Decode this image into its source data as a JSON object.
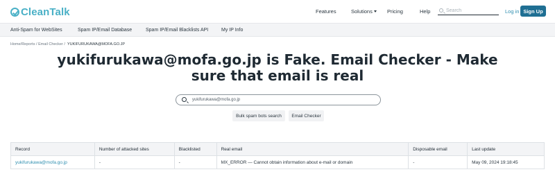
{
  "header": {
    "logo_text": "CleanTalk",
    "nav": [
      "Features",
      "Solutions",
      "Pricing",
      "Help"
    ],
    "search_placeholder": "Search",
    "login_label": "Log in",
    "signup_label": "Sign Up"
  },
  "subnav": [
    "Anti-Spam for WebSites",
    "Spam IP/Email Database",
    "Spam IP/Email Blacklists API",
    "My IP Info"
  ],
  "breadcrumb": {
    "home": "Home",
    "reports": "Reports",
    "email_checker": "Email Checker",
    "current": "YUKIFURUKAWA@MOFA.GO.JP"
  },
  "page_title": "yukifurukawa@mofa.go.jp is Fake. Email Checker - Make sure that email is real",
  "main_search": {
    "value": "yukifurukawa@mofa.go.jp"
  },
  "buttons": {
    "bulk": "Bulk spam bots search",
    "checker": "Email Checker"
  },
  "table": {
    "headers": [
      "Record",
      "Number of attacked sites",
      "Blacklisted",
      "Real email",
      "Disposable email",
      "Last update"
    ],
    "rows": [
      [
        "yukifurukawa@mofa.go.jp",
        "-",
        "-",
        "MX_ERROR — Cannot obtain information about e-mail or domain",
        "-",
        "May 09, 2024 19:18:45"
      ]
    ]
  },
  "colors": {
    "brand": "#49b0c6",
    "signup_bg": "#1f6f93",
    "link": "#2f8fb0"
  }
}
